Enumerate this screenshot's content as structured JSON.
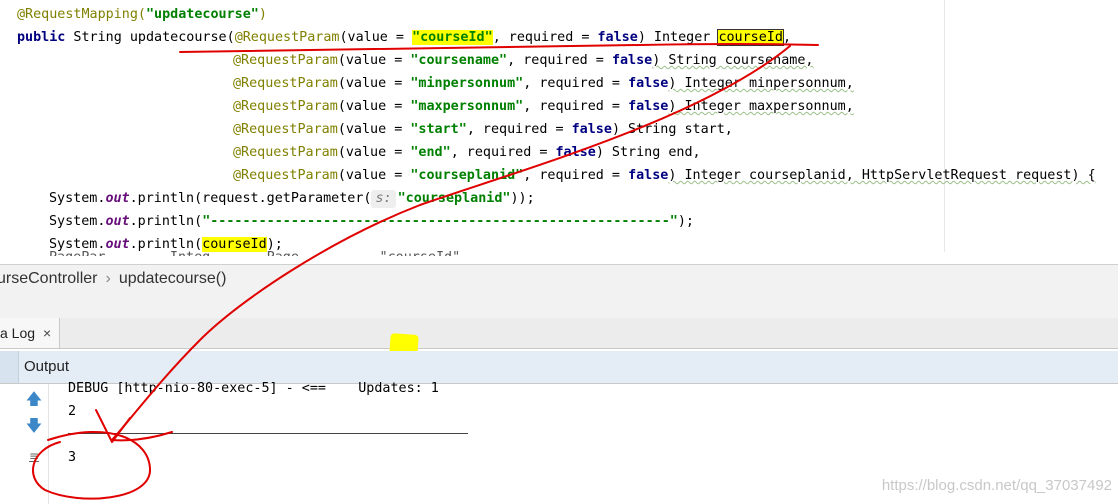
{
  "editor": {
    "lines": [
      [
        "@RequestMapping(",
        "\"updatecourse\"",
        ")"
      ],
      [
        "public",
        " String ",
        "updatecourse",
        "(",
        "@RequestParam",
        "(value = ",
        "\"courseId\"",
        ", required = ",
        "false",
        ") Integer ",
        "courseId",
        ","
      ],
      [
        "@RequestParam",
        "(value = ",
        "\"coursename\"",
        ", required = ",
        "false",
        ") String coursename,"
      ],
      [
        "@RequestParam",
        "(value = ",
        "\"minpersonnum\"",
        ", required = ",
        "false",
        ") Integer minpersonnum,"
      ],
      [
        "@RequestParam",
        "(value = ",
        "\"maxpersonnum\"",
        ", required = ",
        "false",
        ") Integer maxpersonnum,"
      ],
      [
        "@RequestParam",
        "(value = ",
        "\"start\"",
        ", required = ",
        "false",
        ") String start,"
      ],
      [
        "@RequestParam",
        "(value = ",
        "\"end\"",
        ", required = ",
        "false",
        ") String end,"
      ],
      [
        "@RequestParam",
        "(value = ",
        "\"courseplanid\"",
        ", required = ",
        "false",
        ") Integer courseplanid, HttpServletRequest request) {"
      ],
      [
        "System.",
        "out",
        ".println(request.getParameter(",
        "s:",
        "\"courseplanid\"",
        "));"
      ],
      [
        "System.",
        "out",
        ".println(",
        "\"---------------------------------------------------------\"",
        ");"
      ],
      [
        "System.",
        "out",
        ".println(",
        "courseId",
        ");"
      ]
    ],
    "partial_line": "PagePar        Integ       Page          \"courseId\""
  },
  "breadcrumb": {
    "items": [
      "urseController",
      "updatecourse()"
    ],
    "separator": "›"
  },
  "tabs": [
    {
      "label": "a Log",
      "close": "×"
    }
  ],
  "output": {
    "title": "Output",
    "lines": [
      "DEBUG [http-nio-80-exec-5] - <==    Updates: 1",
      "2",
      "3"
    ],
    "tools": [
      "arrow-up-icon",
      "arrow-down-icon",
      "soft-wrap-icon"
    ]
  },
  "watermark": "https://blog.csdn.net/qq_37037492",
  "colors": {
    "annotation": "#808000",
    "keyword": "#000080",
    "string": "#008000",
    "highlight": "#ffff00",
    "ink": "#e00000"
  }
}
